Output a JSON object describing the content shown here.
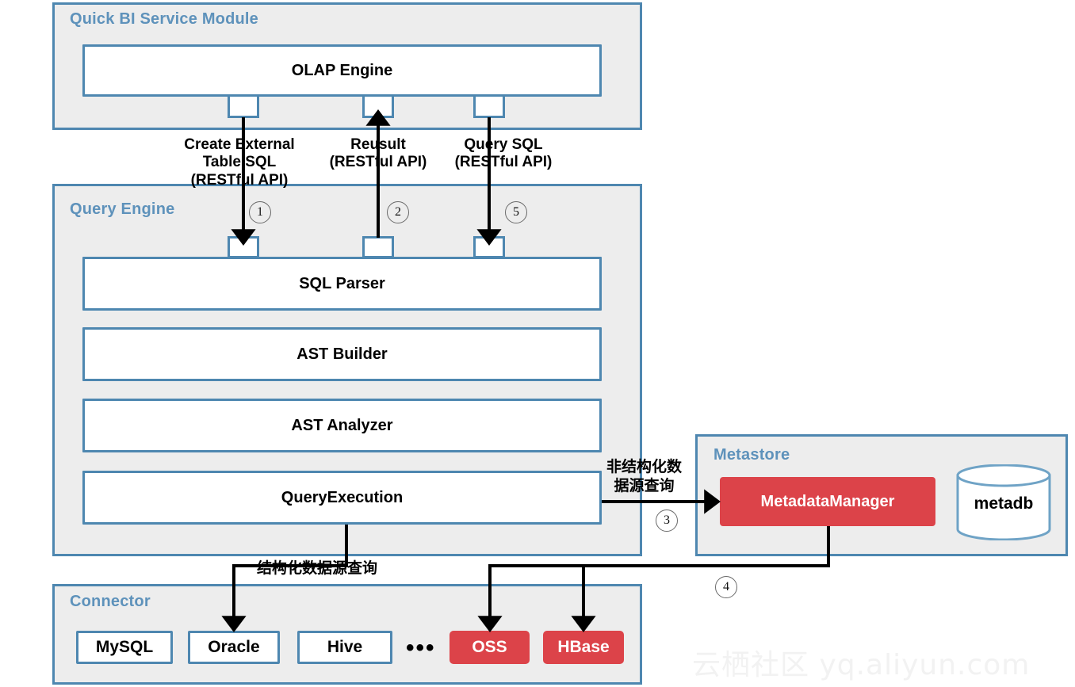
{
  "diagram": {
    "title_watermark": "云栖社区 yq.aliyun.com",
    "colors": {
      "panel_border": "#4e87b0",
      "panel_fill": "#ededed",
      "panel_title": "#5e92bb",
      "accent_red": "#dc4349",
      "box_fill": "#ffffff",
      "arrow": "#000000"
    }
  },
  "panels": {
    "quick_bi": {
      "title": "Quick BI Service Module"
    },
    "query_engine": {
      "title": "Query Engine"
    },
    "metastore": {
      "title": "Metastore"
    },
    "connector": {
      "title": "Connector"
    }
  },
  "boxes": {
    "olap_engine": "OLAP Engine",
    "sql_parser": "SQL Parser",
    "ast_builder": "AST Builder",
    "ast_analyzer": "AST Analyzer",
    "query_execution": "QueryExecution",
    "metadata_manager": "MetadataManager",
    "metadb": "metadb"
  },
  "connectors": [
    {
      "label": "MySQL",
      "style": "plain"
    },
    {
      "label": "Oracle",
      "style": "plain"
    },
    {
      "label": "Hive",
      "style": "plain"
    },
    {
      "label": "•••",
      "style": "ellipsis"
    },
    {
      "label": "OSS",
      "style": "red"
    },
    {
      "label": "HBase",
      "style": "red"
    }
  ],
  "edges": [
    {
      "id": "create-external-table-sql",
      "label": "Create External\nTable SQL\n(RESTful API)",
      "step": "1",
      "direction": "down"
    },
    {
      "id": "result",
      "label": "Reusult\n(RESTful API)",
      "step": "2",
      "direction": "up"
    },
    {
      "id": "query-sql",
      "label": "Query SQL\n(RESTful API)",
      "step": "5",
      "direction": "down"
    },
    {
      "id": "unstructured-datasource-query",
      "label": "非结构化数\n据源查询",
      "step": "3",
      "direction": "right"
    },
    {
      "id": "metadata-to-unstructured-connectors",
      "label": "",
      "step": "4",
      "direction": "down"
    },
    {
      "id": "structured-datasource-query",
      "label": "结构化数据源查询",
      "step": "",
      "direction": "down"
    }
  ]
}
